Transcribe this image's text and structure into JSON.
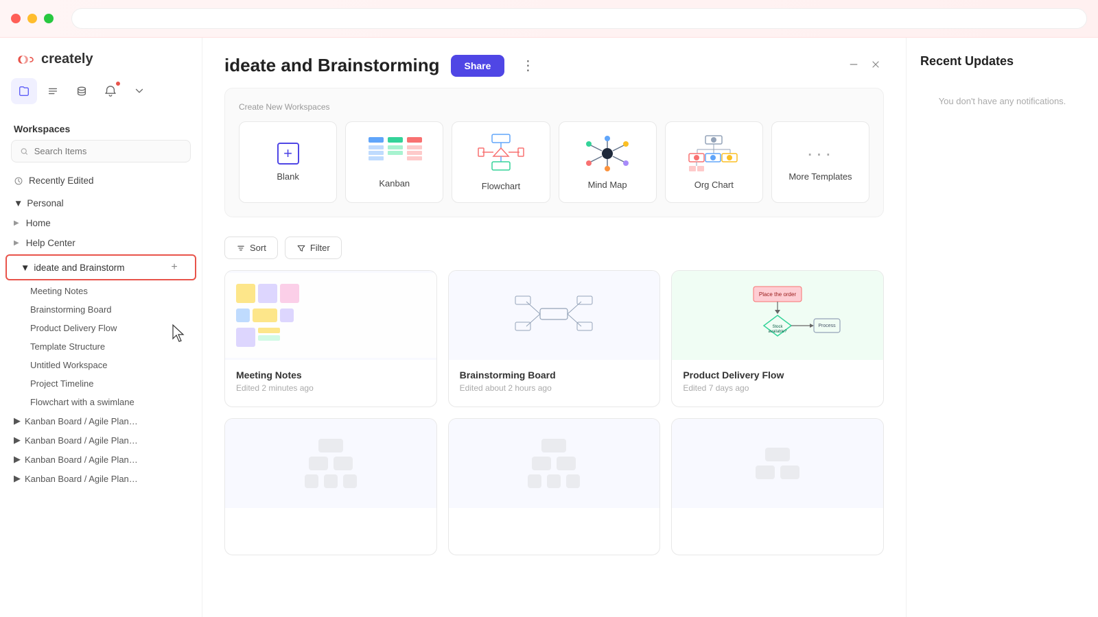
{
  "titlebar": {
    "url_placeholder": ""
  },
  "sidebar": {
    "logo_text": "creately",
    "workspaces_label": "Workspaces",
    "search_placeholder": "Search Items",
    "recently_edited_label": "Recently Edited",
    "personal_label": "Personal",
    "nav_items": [
      {
        "id": "home",
        "label": "Home"
      },
      {
        "id": "help-center",
        "label": "Help Center"
      }
    ],
    "ideate_label": "ideate and Brainstorm",
    "sub_items": [
      {
        "id": "meeting-notes",
        "label": "Meeting Notes"
      },
      {
        "id": "brainstorming-board",
        "label": "Brainstorming Board"
      },
      {
        "id": "product-delivery-flow",
        "label": "Product Delivery Flow"
      },
      {
        "id": "template-structure",
        "label": "Template Structure"
      },
      {
        "id": "untitled-workspace",
        "label": "Untitled Workspace"
      },
      {
        "id": "project-timeline",
        "label": "Project Timeline"
      },
      {
        "id": "flowchart-swimlane",
        "label": "Flowchart with a swimlane"
      }
    ],
    "kanban_items": [
      {
        "id": "kanban-1",
        "label": "Kanban Board / Agile Plan…"
      },
      {
        "id": "kanban-2",
        "label": "Kanban Board / Agile Plan…"
      },
      {
        "id": "kanban-3",
        "label": "Kanban Board / Agile Plan…"
      },
      {
        "id": "kanban-4",
        "label": "Kanban Board / Agile Plan…"
      }
    ]
  },
  "main": {
    "title": "ideate and Brainstorming",
    "share_label": "Share",
    "create_section_label": "Create New Workspaces",
    "templates": [
      {
        "id": "blank",
        "label": "Blank",
        "type": "blank"
      },
      {
        "id": "kanban",
        "label": "Kanban",
        "type": "kanban"
      },
      {
        "id": "flowchart",
        "label": "Flowchart",
        "type": "flowchart"
      },
      {
        "id": "mindmap",
        "label": "Mind Map",
        "type": "mindmap"
      },
      {
        "id": "orgchart",
        "label": "Org Chart",
        "type": "orgchart"
      },
      {
        "id": "more",
        "label": "More Templates",
        "type": "more"
      }
    ],
    "sort_label": "Sort",
    "filter_label": "Filter",
    "workspaces": [
      {
        "id": "meeting-notes",
        "title": "Meeting Notes",
        "time": "Edited 2 minutes ago",
        "thumb_type": "meeting"
      },
      {
        "id": "brainstorming-board",
        "title": "Brainstorming Board",
        "time": "Edited about 2 hours ago",
        "thumb_type": "brainstorm"
      },
      {
        "id": "product-delivery",
        "title": "Product Delivery Flow",
        "time": "Edited 7 days ago",
        "thumb_type": "product"
      },
      {
        "id": "ws4",
        "title": "",
        "time": "",
        "thumb_type": "placeholder"
      },
      {
        "id": "ws5",
        "title": "",
        "time": "",
        "thumb_type": "placeholder"
      },
      {
        "id": "ws6",
        "title": "",
        "time": "",
        "thumb_type": "placeholder"
      }
    ]
  },
  "right_panel": {
    "title": "Recent Updates",
    "empty_message": "You don't have any notifications."
  }
}
